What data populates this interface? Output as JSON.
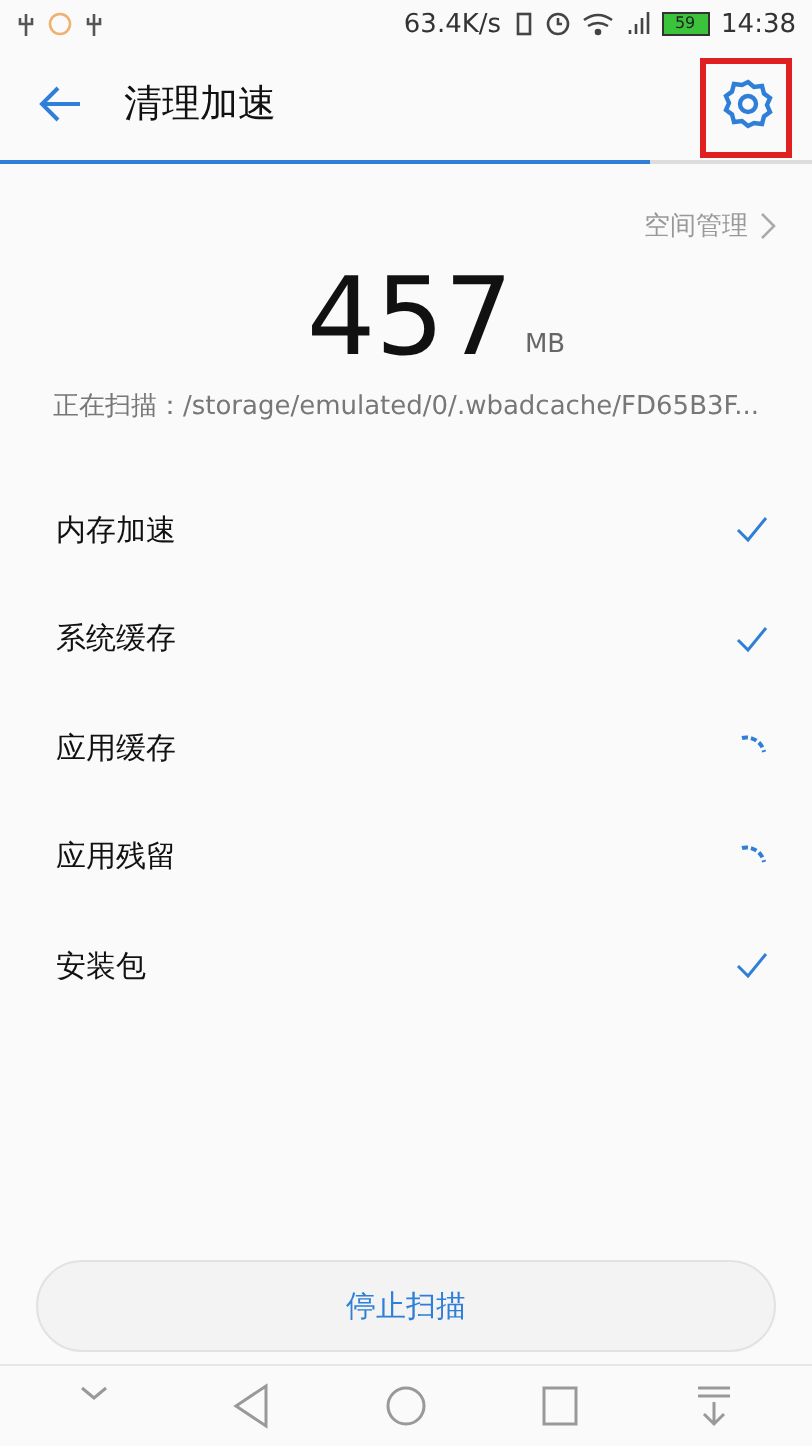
{
  "status_bar": {
    "speed": "63.4K/s",
    "battery": "59",
    "time": "14:38"
  },
  "header": {
    "title": "清理加速",
    "settings_highlighted": true
  },
  "progress": {
    "level": 0.8
  },
  "space_link": "空间管理",
  "size": {
    "value": "457",
    "unit": "MB"
  },
  "scanning": "正在扫描：/storage/emulated/0/.wbadcache/FD65B3F...",
  "items": [
    {
      "label": "内存加速",
      "done": true
    },
    {
      "label": "系统缓存",
      "done": true
    },
    {
      "label": "应用缓存",
      "done": false
    },
    {
      "label": "应用残留",
      "done": false
    },
    {
      "label": "安装包",
      "done": true
    }
  ],
  "stop_button": "停止扫描"
}
